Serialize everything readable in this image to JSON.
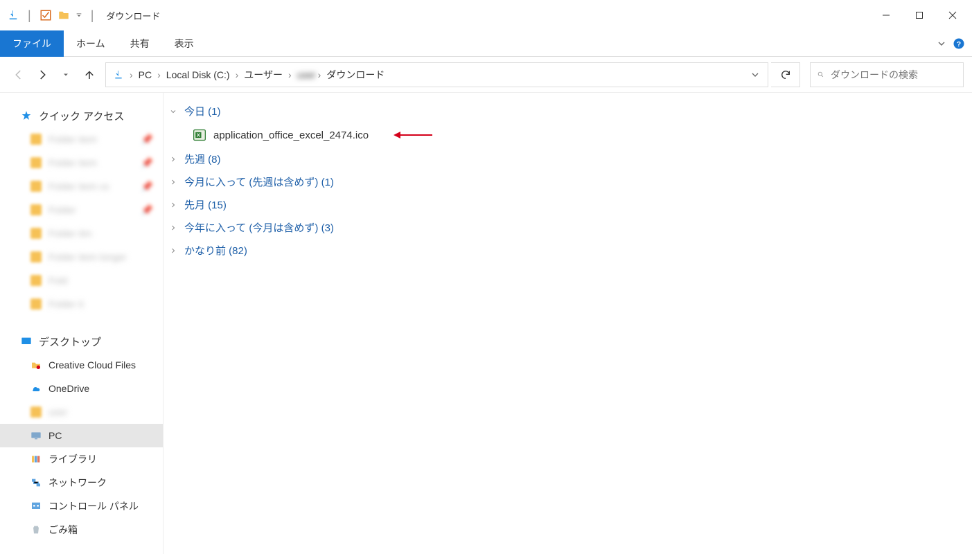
{
  "title": "ダウンロード",
  "ribbon": {
    "file": "ファイル",
    "home": "ホーム",
    "share": "共有",
    "view": "表示"
  },
  "breadcrumb": [
    "PC",
    "Local Disk (C:)",
    "ユーザー",
    "",
    "ダウンロード"
  ],
  "search_placeholder": "ダウンロードの検索",
  "sidebar": {
    "quick_access": "クイック アクセス",
    "desktop": "デスクトップ",
    "ccf": "Creative Cloud Files",
    "onedrive": "OneDrive",
    "pc": "PC",
    "libraries": "ライブラリ",
    "network": "ネットワーク",
    "control_panel": "コントロール パネル",
    "recycle": "ごみ箱"
  },
  "groups": {
    "today": "今日 (1)",
    "last_week": "先週 (8)",
    "this_month": "今月に入って (先週は含めず) (1)",
    "last_month": "先月 (15)",
    "this_year": "今年に入って (今月は含めず) (3)",
    "long_ago": "かなり前 (82)"
  },
  "file": {
    "name": "application_office_excel_2474.ico"
  }
}
